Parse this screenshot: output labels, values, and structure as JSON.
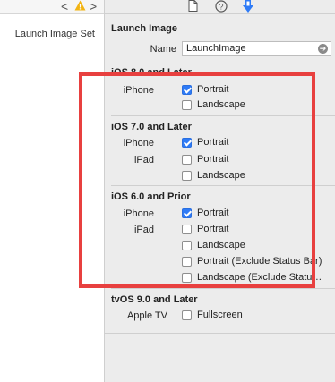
{
  "left_pane": {
    "item_label": "Launch Image Set",
    "nav_back": "<",
    "nav_forward": ">",
    "warning_glyph": "!"
  },
  "inspector": {
    "section_title": "Launch Image",
    "name_label": "Name",
    "name_value": "LaunchImage",
    "groups": [
      {
        "title": "iOS 8.0 and Later",
        "rows": [
          {
            "device": "iPhone",
            "option": "Portrait",
            "checked": true
          },
          {
            "device": "",
            "option": "Landscape",
            "checked": false
          }
        ]
      },
      {
        "title": "iOS 7.0 and Later",
        "rows": [
          {
            "device": "iPhone",
            "option": "Portrait",
            "checked": true
          },
          {
            "device": "iPad",
            "option": "Portrait",
            "checked": false
          },
          {
            "device": "",
            "option": "Landscape",
            "checked": false
          }
        ]
      },
      {
        "title": "iOS 6.0 and Prior",
        "rows": [
          {
            "device": "iPhone",
            "option": "Portrait",
            "checked": true
          },
          {
            "device": "iPad",
            "option": "Portrait",
            "checked": false
          },
          {
            "device": "",
            "option": "Landscape",
            "checked": false
          },
          {
            "device": "",
            "option": "Portrait (Exclude Status Bar)",
            "checked": false
          },
          {
            "device": "",
            "option": "Landscape (Exclude Statu…",
            "checked": false
          }
        ]
      },
      {
        "title": "tvOS 9.0 and Later",
        "rows": [
          {
            "device": "Apple TV",
            "option": "Fullscreen",
            "checked": false
          }
        ]
      }
    ]
  },
  "toolbar": {
    "icons": [
      "file-icon",
      "help-icon",
      "attributes-inspector-icon"
    ],
    "help_glyph": "?"
  },
  "colors": {
    "accent": "#2f7bf6",
    "highlight_box": "#e8403f",
    "warning": "#f2b413"
  }
}
